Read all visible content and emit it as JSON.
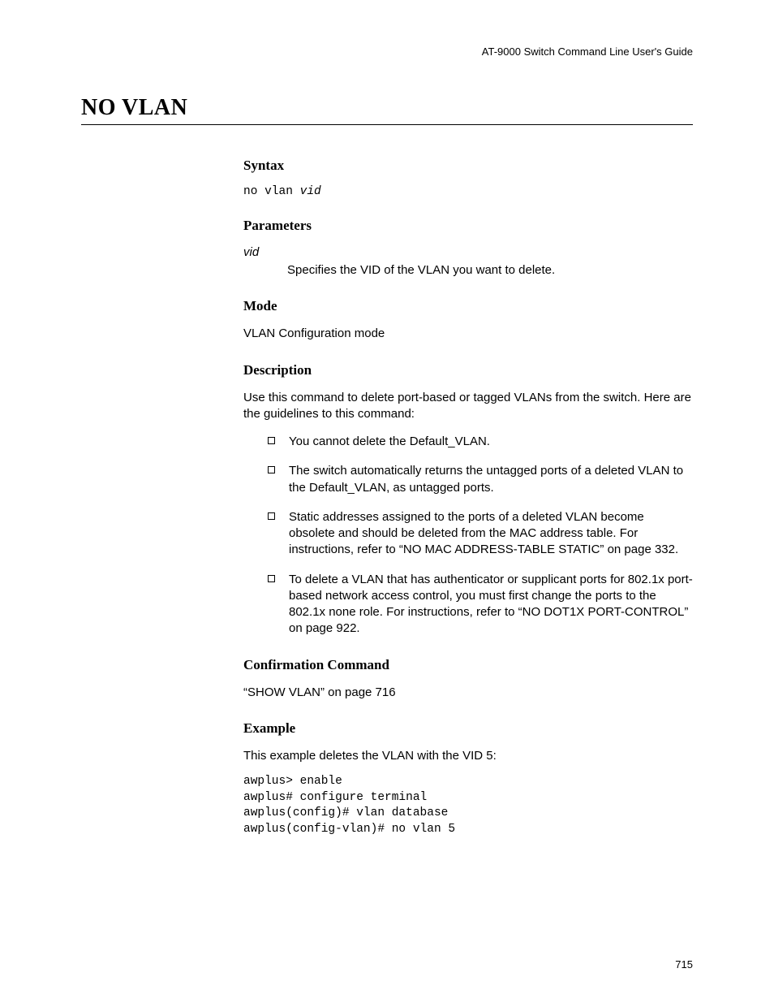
{
  "header": "AT-9000 Switch Command Line User's Guide",
  "title": "NO VLAN",
  "sections": {
    "syntax": {
      "heading": "Syntax",
      "command": "no vlan",
      "arg": "vid"
    },
    "parameters": {
      "heading": "Parameters",
      "items": [
        {
          "name": "vid",
          "desc": "Specifies the VID of the VLAN you want to delete."
        }
      ]
    },
    "mode": {
      "heading": "Mode",
      "text": "VLAN Configuration mode"
    },
    "description": {
      "heading": "Description",
      "intro": "Use this command to delete port-based or tagged VLANs from the switch. Here are the guidelines to this command:",
      "bullets": [
        "You cannot delete the Default_VLAN.",
        "The switch automatically returns the untagged ports of a deleted VLAN to the Default_VLAN, as untagged ports.",
        "Static addresses assigned to the ports of a deleted VLAN become obsolete and should be deleted from the MAC address table. For instructions, refer to “NO MAC ADDRESS-TABLE STATIC” on page 332.",
        "To delete a VLAN that has authenticator or supplicant ports for 802.1x port-based network access control, you must first change the ports to the 802.1x none role. For instructions, refer to “NO DOT1X PORT-CONTROL” on page 922."
      ]
    },
    "confirmation": {
      "heading": "Confirmation Command",
      "text": "“SHOW VLAN” on page 716"
    },
    "example": {
      "heading": "Example",
      "intro": "This example deletes the VLAN with the VID 5:",
      "code": "awplus> enable\nawplus# configure terminal\nawplus(config)# vlan database\nawplus(config-vlan)# no vlan 5"
    }
  },
  "pageNumber": "715"
}
